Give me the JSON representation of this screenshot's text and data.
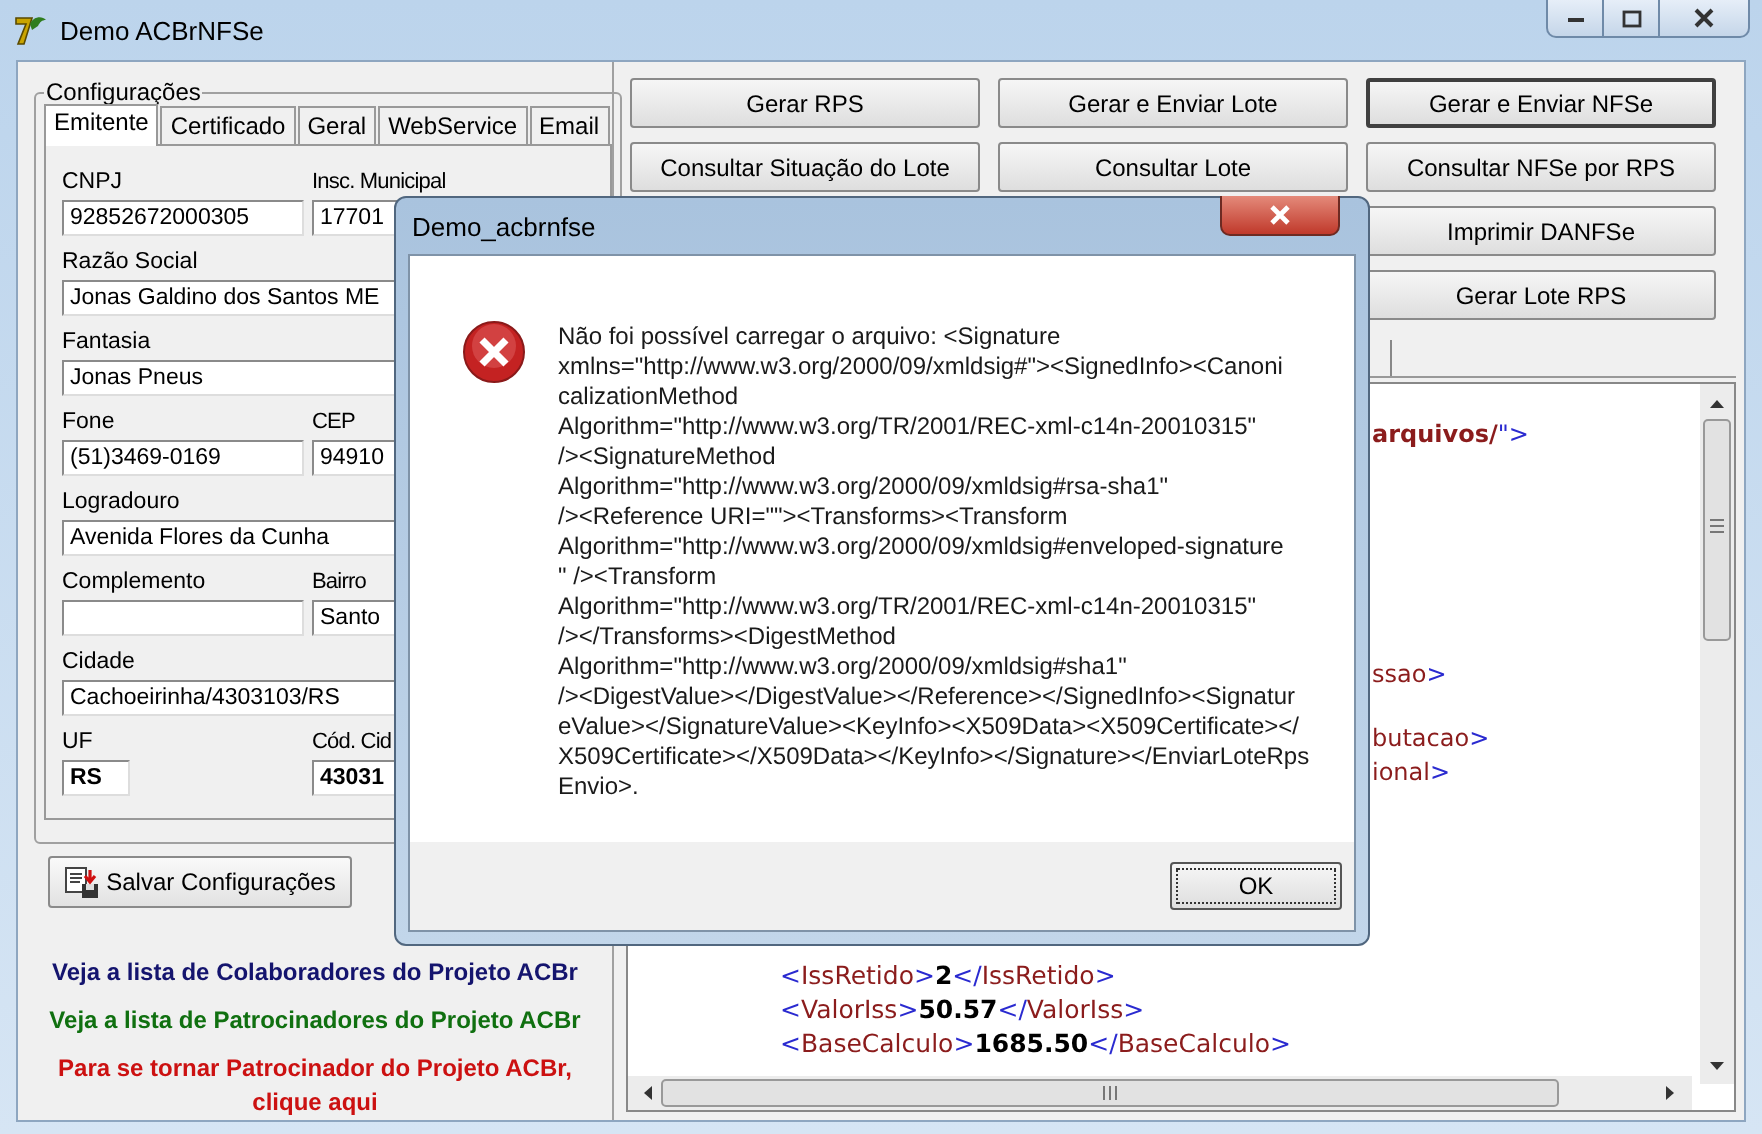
{
  "window": {
    "title": "Demo ACBrNFSe"
  },
  "config": {
    "title": "Configurações",
    "tabs": [
      {
        "label": "Emitente",
        "selected": true
      },
      {
        "label": "Certificado",
        "selected": false
      },
      {
        "label": "Geral",
        "selected": false
      },
      {
        "label": "WebService",
        "selected": false
      },
      {
        "label": "Email",
        "selected": false
      }
    ],
    "rows": [
      [
        {
          "label": "CNPJ",
          "value": "92852672000305",
          "bold": false,
          "kind": "normal"
        },
        {
          "label": "Insc. Municipal",
          "value": "17701",
          "bold": false,
          "kind": "normal"
        }
      ],
      [
        {
          "label": "Razão Social",
          "value": "Jonas Galdino dos Santos ME",
          "bold": false,
          "kind": "normal"
        }
      ],
      [
        {
          "label": "Fantasia",
          "value": "Jonas Pneus",
          "bold": false,
          "kind": "normal"
        }
      ],
      [
        {
          "label": "Fone",
          "value": "(51)3469-0169",
          "bold": false,
          "kind": "normal"
        },
        {
          "label": "CEP",
          "value": "94910",
          "bold": false,
          "kind": "normal"
        }
      ],
      [
        {
          "label": "Logradouro",
          "value": "Avenida Flores da Cunha",
          "bold": false,
          "kind": "normal"
        }
      ],
      [
        {
          "label": "Complemento",
          "kind": "normal"
        },
        {
          "label": "Bairro",
          "value": "Santo",
          "bold": false,
          "kind": "normal"
        }
      ],
      [
        {
          "label": "Cidade",
          "value": "Cachoeirinha/4303103/RS",
          "bold": false,
          "kind": "normal"
        }
      ],
      [
        {
          "label": "UF",
          "value": "RS",
          "bold": true,
          "kind": "short"
        },
        {
          "label": "Cód. Cid",
          "value": "43031",
          "bold": true,
          "kind": "normal"
        }
      ]
    ]
  },
  "save_button": "Salvar Configurações",
  "links": [
    {
      "text": "Veja a lista de Colaboradores do Projeto ACBr",
      "color": "#14146e"
    },
    {
      "text": "Veja a lista de Patrocinadores do Projeto ACBr",
      "color": "#107010"
    },
    {
      "text": "Para se tornar Patrocinador do Projeto ACBr, clique aqui",
      "color": "#cc1111"
    }
  ],
  "actions": [
    {
      "label": "Gerar RPS",
      "focused": false
    },
    {
      "label": "Gerar e Enviar Lote",
      "focused": false
    },
    {
      "label": "Gerar e Enviar NFSe",
      "focused": true
    },
    {
      "label": "Consultar Situação do Lote",
      "focused": false
    },
    {
      "label": "Consultar Lote",
      "focused": false
    },
    {
      "label": "Consultar NFSe por RPS",
      "focused": false
    },
    {
      "label": "Imprimir DANFSe",
      "focused": false
    },
    {
      "label": "Gerar Lote RPS",
      "focused": false
    }
  ],
  "xml": {
    "fragments": [
      [
        {
          "text": "arquivos/",
          "kind": "attr"
        },
        {
          "text": "\">",
          "kind": "punct"
        }
      ],
      [
        {
          "text": "ssao",
          "kind": "name"
        },
        {
          "text": ">",
          "kind": "punct"
        }
      ],
      [
        {
          "text": "butacao",
          "kind": "name"
        },
        {
          "text": ">",
          "kind": "punct"
        }
      ],
      [
        {
          "text": "ional",
          "kind": "name"
        },
        {
          "text": ">",
          "kind": "punct"
        }
      ]
    ],
    "lines": [
      [
        {
          "text": "<",
          "kind": "punct"
        },
        {
          "text": "IssRetido",
          "kind": "name"
        },
        {
          "text": ">",
          "kind": "punct"
        },
        {
          "text": "2",
          "kind": "value"
        },
        {
          "text": "</",
          "kind": "punct"
        },
        {
          "text": "IssRetido",
          "kind": "name"
        },
        {
          "text": ">",
          "kind": "punct"
        }
      ],
      [
        {
          "text": "<",
          "kind": "punct"
        },
        {
          "text": "ValorIss",
          "kind": "name"
        },
        {
          "text": ">",
          "kind": "punct"
        },
        {
          "text": "50.57",
          "kind": "value"
        },
        {
          "text": "</",
          "kind": "punct"
        },
        {
          "text": "ValorIss",
          "kind": "name"
        },
        {
          "text": ">",
          "kind": "punct"
        }
      ],
      [
        {
          "text": "<",
          "kind": "punct"
        },
        {
          "text": "BaseCalculo",
          "kind": "name"
        },
        {
          "text": ">",
          "kind": "punct"
        },
        {
          "text": "1685.50",
          "kind": "value"
        },
        {
          "text": "</",
          "kind": "punct"
        },
        {
          "text": "BaseCalculo",
          "kind": "name"
        },
        {
          "text": ">",
          "kind": "punct"
        }
      ]
    ]
  },
  "dialog": {
    "title": "Demo_acbrnfse",
    "message_lines": [
      "Não foi possível carregar o arquivo: <Signature",
      "xmlns=\"http://www.w3.org/2000/09/xmldsig#\"><SignedInfo><Canoni",
      "calizationMethod",
      "Algorithm=\"http://www.w3.org/TR/2001/REC-xml-c14n-20010315\"",
      "/><SignatureMethod",
      "Algorithm=\"http://www.w3.org/2000/09/xmldsig#rsa-sha1\"",
      "/><Reference URI=\"\"><Transforms><Transform",
      "Algorithm=\"http://www.w3.org/2000/09/xmldsig#enveloped-signature",
      "\" /><Transform",
      "Algorithm=\"http://www.w3.org/TR/2001/REC-xml-c14n-20010315\"",
      "/></Transforms><DigestMethod",
      "Algorithm=\"http://www.w3.org/2000/09/xmldsig#sha1\"",
      "/><DigestValue></DigestValue></Reference></SignedInfo><Signatur",
      "eValue></SignatureValue><KeyInfo><X509Data><X509Certificate></",
      "X509Certificate></X509Data></KeyInfo></Signature></EnviarLoteRps",
      "Envio>."
    ],
    "button": "OK"
  }
}
